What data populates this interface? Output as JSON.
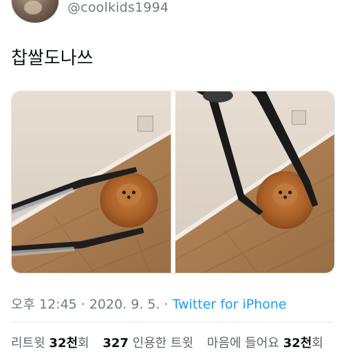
{
  "header": {
    "handle": "@coolkids1994"
  },
  "tweet": {
    "text": "찹쌀도나쓰"
  },
  "media": {
    "photos": [
      {
        "description_icon": "photo-dog-tongs-horizontal"
      },
      {
        "description_icon": "photo-dog-tongs-vertical"
      }
    ]
  },
  "meta": {
    "time": "오후 12:45",
    "separator": "·",
    "date": "2020. 9. 5.",
    "source": "Twitter for iPhone"
  },
  "stats": {
    "retweets_label": "리트윗",
    "retweets_count": "32천",
    "retweets_suffix": "회",
    "quotes_count": "327",
    "quotes_label": "인용한 트윗",
    "likes_label": "마음에 들어요",
    "likes_count": "32천",
    "likes_suffix": "회"
  },
  "colors": {
    "link": "#1d9bf0",
    "muted": "#6e7b86",
    "text": "#0f1419"
  }
}
